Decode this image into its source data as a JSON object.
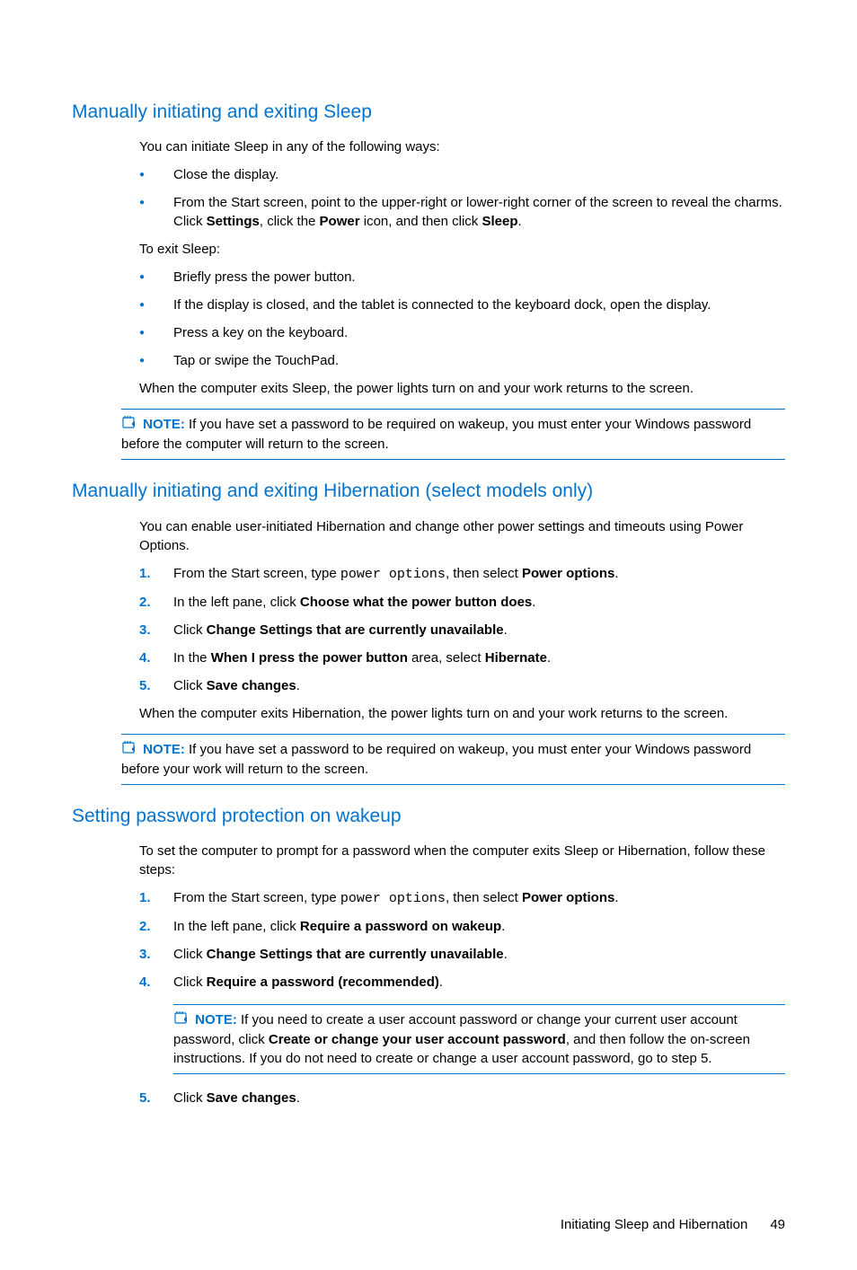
{
  "section1": {
    "heading": "Manually initiating and exiting Sleep",
    "intro": "You can initiate Sleep in any of the following ways:",
    "bullets1": {
      "b0": "Close the display.",
      "b1_pre": "From the Start screen, point to the upper-right or lower-right corner of the screen to reveal the charms. Click ",
      "b1_bold1": "Settings",
      "b1_mid": ", click the ",
      "b1_bold2": "Power",
      "b1_mid2": " icon, and then click ",
      "b1_bold3": "Sleep",
      "b1_end": "."
    },
    "exit_intro": "To exit Sleep:",
    "bullets2": {
      "b0": "Briefly press the power button.",
      "b1": "If the display is closed, and the tablet is connected to the keyboard dock, open the display.",
      "b2": "Press a key on the keyboard.",
      "b3": "Tap or swipe the TouchPad."
    },
    "after": "When the computer exits Sleep, the power lights turn on and your work returns to the screen.",
    "note_label": "NOTE:",
    "note_text": "If you have set a password to be required on wakeup, you must enter your Windows password before the computer will return to the screen."
  },
  "section2": {
    "heading": "Manually initiating and exiting Hibernation (select models only)",
    "intro": "You can enable user-initiated Hibernation and change other power settings and timeouts using Power Options.",
    "steps": {
      "s1_pre": "From the Start screen, type ",
      "s1_mono": "power options",
      "s1_mid": ", then select ",
      "s1_bold": "Power options",
      "s1_end": ".",
      "s2_pre": "In the left pane, click ",
      "s2_bold": "Choose what the power button does",
      "s2_end": ".",
      "s3_pre": "Click ",
      "s3_bold": "Change Settings that are currently unavailable",
      "s3_end": ".",
      "s4_pre": "In the ",
      "s4_bold1": "When I press the power button",
      "s4_mid": " area, select ",
      "s4_bold2": "Hibernate",
      "s4_end": ".",
      "s5_pre": "Click ",
      "s5_bold": "Save changes",
      "s5_end": "."
    },
    "after": "When the computer exits Hibernation, the power lights turn on and your work returns to the screen.",
    "note_label": "NOTE:",
    "note_text": "If you have set a password to be required on wakeup, you must enter your Windows password before your work will return to the screen."
  },
  "section3": {
    "heading": "Setting password protection on wakeup",
    "intro": "To set the computer to prompt for a password when the computer exits Sleep or Hibernation, follow these steps:",
    "steps": {
      "s1_pre": "From the Start screen, type ",
      "s1_mono": "power options",
      "s1_mid": ", then select ",
      "s1_bold": "Power options",
      "s1_end": ".",
      "s2_pre": "In the left pane, click ",
      "s2_bold": "Require a password on wakeup",
      "s2_end": ".",
      "s3_pre": "Click ",
      "s3_bold": "Change Settings that are currently unavailable",
      "s3_end": ".",
      "s4_pre": "Click ",
      "s4_bold": "Require a password (recommended)",
      "s4_end": ".",
      "note_label": "NOTE:",
      "note_pre": "If you need to create a user account password or change your current user account password, click ",
      "note_bold": "Create or change your user account password",
      "note_post": ", and then follow the on-screen instructions. If you do not need to create or change a user account password, go to step 5.",
      "s5_pre": "Click ",
      "s5_bold": "Save changes",
      "s5_end": "."
    }
  },
  "footer": {
    "text": "Initiating Sleep and Hibernation",
    "page": "49"
  }
}
